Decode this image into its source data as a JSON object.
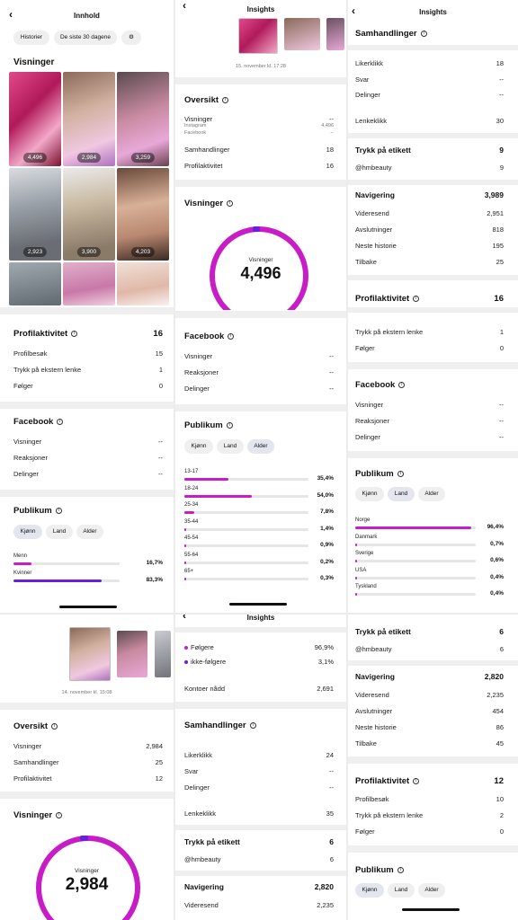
{
  "accent": "#c81dc6",
  "accent2": "#6a1ee0",
  "p1": {
    "title": "Innhold",
    "filters": [
      "Historier",
      "De siste 30 dagene"
    ],
    "views_title": "Visninger",
    "grid_counts": [
      "4,496",
      "2,984",
      "3,259",
      "2,923",
      "3,900",
      "4,203"
    ],
    "profile": {
      "title": "Profilaktivitet",
      "total": "16",
      "rows": [
        [
          "Profilbesøk",
          "15"
        ],
        [
          "Trykk på ekstern lenke",
          "1"
        ],
        [
          "Følger",
          "0"
        ]
      ]
    },
    "facebook": {
      "title": "Facebook",
      "rows": [
        [
          "Visninger",
          "--"
        ],
        [
          "Reaksjoner",
          "--"
        ],
        [
          "Delinger",
          "--"
        ]
      ]
    },
    "audience": {
      "title": "Publikum",
      "tabs": [
        "Kjønn",
        "Land",
        "Alder"
      ],
      "bars": [
        {
          "label": "Menn",
          "pct": "16,7%",
          "value": 16.7
        },
        {
          "label": "Kvinner",
          "pct": "83,3%",
          "value": 83.3
        }
      ]
    }
  },
  "p2": {
    "header_title": "Insights",
    "date": "15. november kl. 17:28",
    "overview": {
      "title": "Oversikt",
      "views_label": "Visninger",
      "views_val": "--",
      "instagram_label": "Instagram",
      "instagram_val": "4,496",
      "facebook_label": "Facebook",
      "facebook_val": "--",
      "rows": [
        [
          "Samhandlinger",
          "18"
        ],
        [
          "Profilaktivitet",
          "16"
        ]
      ]
    },
    "views": {
      "title": "Visninger",
      "center_label": "Visninger",
      "center_value": "4,496"
    },
    "facebook": {
      "title": "Facebook",
      "rows": [
        [
          "Visninger",
          "--"
        ],
        [
          "Reaksjoner",
          "--"
        ],
        [
          "Delinger",
          "--"
        ]
      ]
    },
    "audience": {
      "title": "Publikum",
      "tabs": [
        "Kjønn",
        "Land",
        "Alder"
      ],
      "bars": [
        {
          "label": "13-17",
          "pct": "35,4%",
          "value": 35.4
        },
        {
          "label": "18-24",
          "pct": "54,0%",
          "value": 54.0
        },
        {
          "label": "25-34",
          "pct": "7,8%",
          "value": 7.8
        },
        {
          "label": "35-44",
          "pct": "1,4%",
          "value": 1.4
        },
        {
          "label": "45-54",
          "pct": "0,9%",
          "value": 0.9
        },
        {
          "label": "55-64",
          "pct": "0,2%",
          "value": 0.2
        },
        {
          "label": "65+",
          "pct": "0,3%",
          "value": 0.3
        }
      ]
    }
  },
  "p3": {
    "header_title": "Insights",
    "interactions": {
      "title": "Samhandlinger",
      "rows": [
        [
          "Likerklikk",
          "18"
        ],
        [
          "Svar",
          "--"
        ],
        [
          "Delinger",
          "--"
        ]
      ],
      "link_label": "Lenkeklikk",
      "link_val": "30"
    },
    "tag": {
      "title": "Trykk på etikett",
      "total": "9",
      "rows": [
        [
          "@hmbeauty",
          "9"
        ]
      ]
    },
    "nav": {
      "title": "Navigering",
      "total": "3,989",
      "rows": [
        [
          "Videresend",
          "2,951"
        ],
        [
          "Avslutninger",
          "818"
        ],
        [
          "Neste historie",
          "195"
        ],
        [
          "Tilbake",
          "25"
        ]
      ]
    },
    "profile": {
      "title": "Profilaktivitet",
      "total": "16"
    },
    "profile_rows": [
      [
        "Trykk på ekstern lenke",
        "1"
      ],
      [
        "Følger",
        "0"
      ]
    ],
    "facebook": {
      "title": "Facebook",
      "rows": [
        [
          "Visninger",
          "--"
        ],
        [
          "Reaksjoner",
          "--"
        ],
        [
          "Delinger",
          "--"
        ]
      ]
    },
    "audience": {
      "title": "Publikum",
      "tabs": [
        "Kjønn",
        "Land",
        "Alder"
      ],
      "bars": [
        {
          "label": "Norge",
          "pct": "96,4%",
          "value": 96.4
        },
        {
          "label": "Danmark",
          "pct": "0,7%",
          "value": 0.7
        },
        {
          "label": "Sverige",
          "pct": "0,6%",
          "value": 0.6
        },
        {
          "label": "USA",
          "pct": "0,4%",
          "value": 0.4
        },
        {
          "label": "Tyskland",
          "pct": "0,4%",
          "value": 0.4
        }
      ]
    }
  },
  "p4": {
    "date": "14. november kl. 15:08",
    "overview": {
      "title": "Oversikt",
      "rows": [
        [
          "Visninger",
          "2,984"
        ],
        [
          "Samhandlinger",
          "25"
        ],
        [
          "Profilaktivitet",
          "12"
        ]
      ]
    },
    "views": {
      "title": "Visninger",
      "center_label": "Visninger",
      "center_value": "2,984"
    }
  },
  "p5": {
    "header_title": "Insights",
    "followers": [
      [
        "Følgere",
        "96,9%"
      ],
      [
        "ikke-følgere",
        "3,1%"
      ]
    ],
    "reach_label": "Kontoer nådd",
    "reach_val": "2,691",
    "interactions": {
      "title": "Samhandlinger",
      "rows": [
        [
          "Likerklikk",
          "24"
        ],
        [
          "Svar",
          "--"
        ],
        [
          "Delinger",
          "--"
        ]
      ],
      "link_label": "Lenkeklikk",
      "link_val": "35"
    },
    "tag": {
      "title": "Trykk på etikett",
      "total": "6",
      "rows": [
        [
          "@hmbeauty",
          "6"
        ]
      ]
    },
    "nav": {
      "title": "Navigering",
      "total": "2,820",
      "rows": [
        [
          "Videresend",
          "2,235"
        ]
      ]
    }
  },
  "p6": {
    "tag": {
      "title": "Trykk på etikett",
      "total": "6",
      "rows": [
        [
          "@hmbeauty",
          "6"
        ]
      ]
    },
    "nav": {
      "title": "Navigering",
      "total": "2,820",
      "rows": [
        [
          "Videresend",
          "2,235"
        ],
        [
          "Avslutninger",
          "454"
        ],
        [
          "Neste historie",
          "86"
        ],
        [
          "Tilbake",
          "45"
        ]
      ]
    },
    "profile": {
      "title": "Profilaktivitet",
      "total": "12",
      "rows": [
        [
          "Profilbesøk",
          "10"
        ],
        [
          "Trykk på ekstern lenke",
          "2"
        ],
        [
          "Følger",
          "0"
        ]
      ]
    },
    "audience": {
      "title": "Publikum",
      "tabs": [
        "Kjønn",
        "Land",
        "Alder"
      ]
    }
  }
}
